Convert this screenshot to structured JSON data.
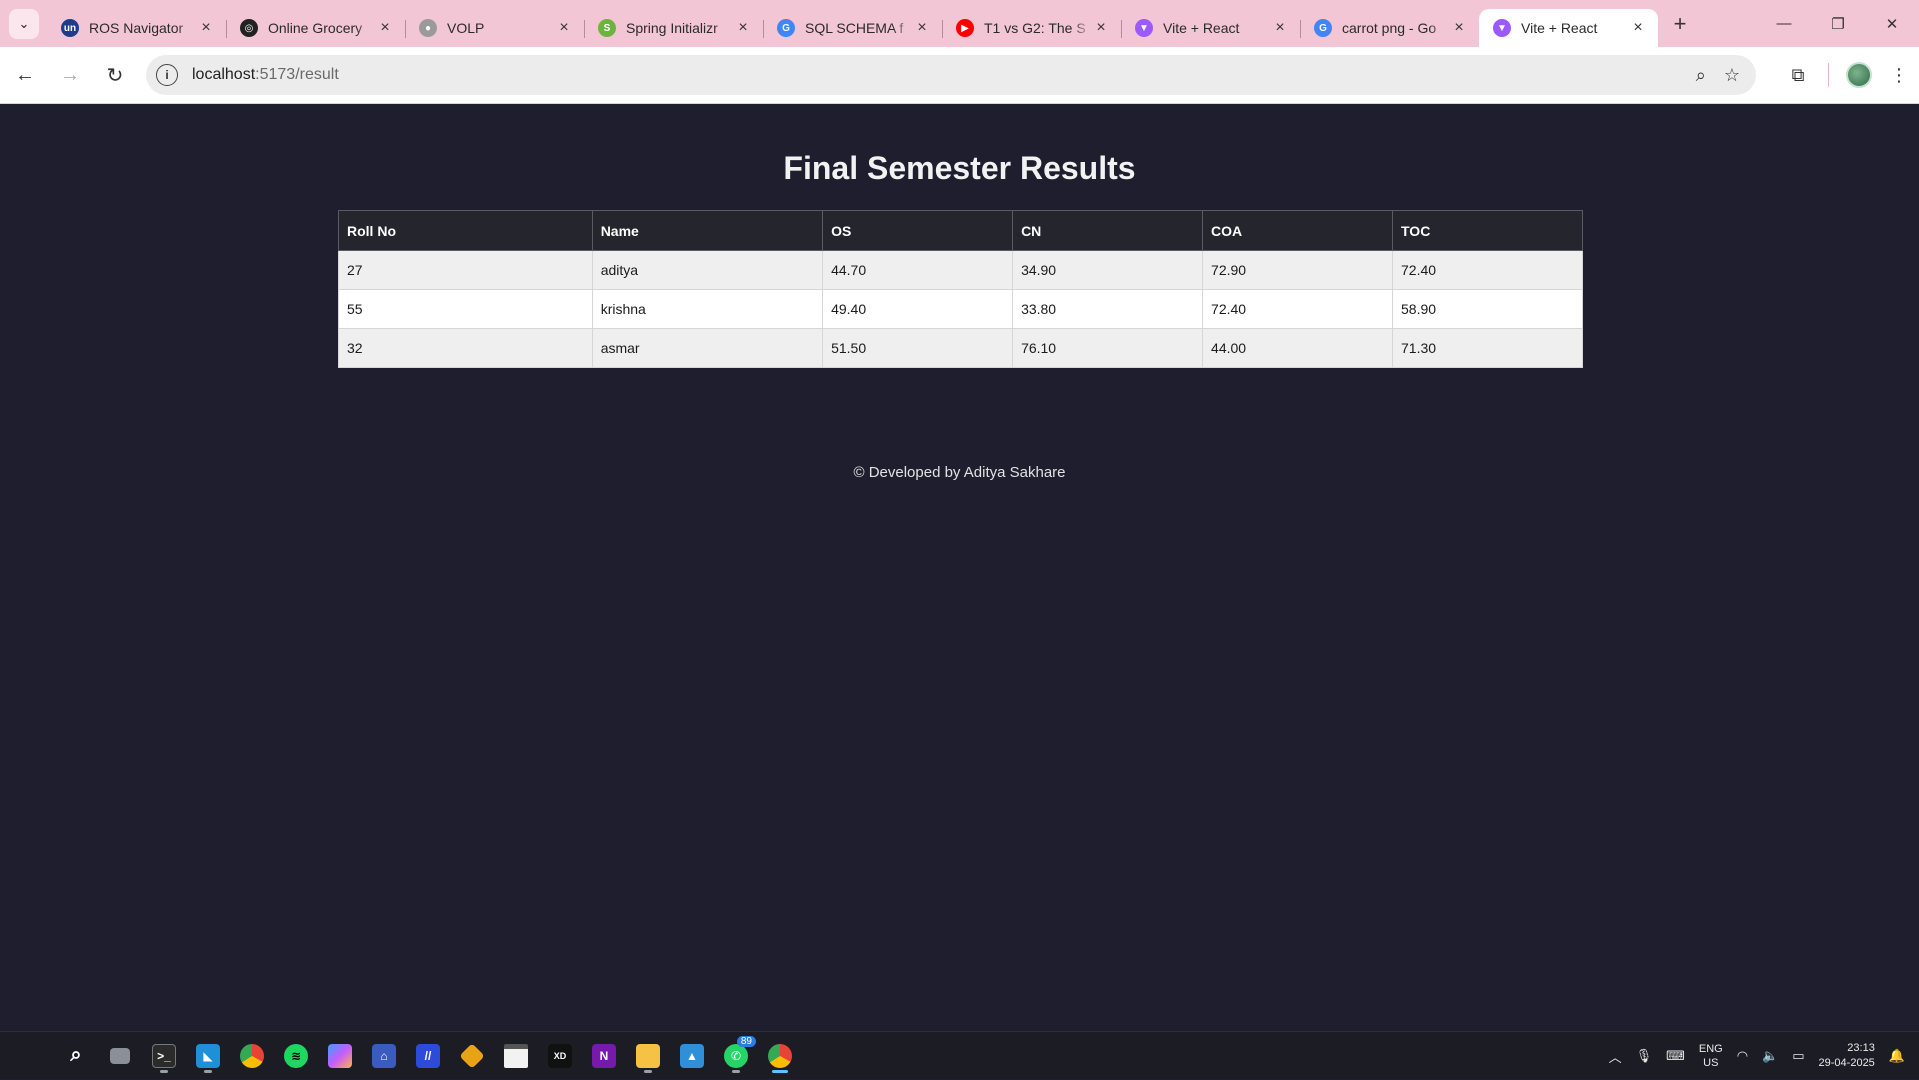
{
  "browser": {
    "tabs": [
      {
        "title": "ROS Navigator",
        "favicon": "un-icon",
        "favicon_text": "un",
        "favicon_color": "#1f3b8a"
      },
      {
        "title": "Online Grocery",
        "favicon": "openai-icon",
        "favicon_text": "◎",
        "favicon_color": "#222222"
      },
      {
        "title": "VOLP",
        "favicon": "globe-icon",
        "favicon_text": "●",
        "favicon_color": "#9a9a9a"
      },
      {
        "title": "Spring Initializr",
        "favicon": "spring-icon",
        "favicon_text": "S",
        "favicon_color": "#6db33f"
      },
      {
        "title": "SQL SCHEMA f",
        "favicon": "google-icon",
        "favicon_text": "G",
        "favicon_color": "#4285f4"
      },
      {
        "title": "T1 vs G2: The S",
        "favicon": "youtube-icon",
        "favicon_text": "▶",
        "favicon_color": "#ff0000"
      },
      {
        "title": "Vite + React",
        "favicon": "vite-icon",
        "favicon_text": "▼",
        "favicon_color": "#9b59ff"
      },
      {
        "title": "carrot png - Go",
        "favicon": "google-icon",
        "favicon_text": "G",
        "favicon_color": "#4285f4"
      },
      {
        "title": "Vite + React",
        "favicon": "vite-icon",
        "favicon_text": "▼",
        "favicon_color": "#9b59ff"
      }
    ],
    "active_tab_index": 8,
    "url_host": "localhost",
    "url_path": ":5173/result"
  },
  "page": {
    "title": "Final Semester Results",
    "table": {
      "headers": [
        "Roll No",
        "Name",
        "OS",
        "CN",
        "COA",
        "TOC"
      ],
      "rows": [
        [
          "27",
          "aditya",
          "44.70",
          "34.90",
          "72.90",
          "72.40"
        ],
        [
          "55",
          "krishna",
          "49.40",
          "33.80",
          "72.40",
          "58.90"
        ],
        [
          "32",
          "asmar",
          "51.50",
          "76.10",
          "44.00",
          "71.30"
        ]
      ]
    },
    "footer": "© Developed by Aditya Sakhare"
  },
  "taskbar": {
    "whatsapp_badge": "89",
    "language_top": "ENG",
    "language_bottom": "US",
    "time": "23:13",
    "date": "29-04-2025"
  },
  "colors": {
    "page_bg": "#1f1e2e",
    "tabstrip_bg": "#f3c6d6",
    "table_header_bg": "#25252d"
  }
}
